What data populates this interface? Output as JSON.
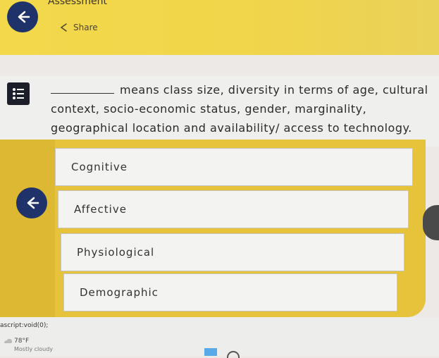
{
  "header": {
    "title": "Assessment",
    "share_label": "Share"
  },
  "question": {
    "text": "means class size, diversity in terms of age, cultural context, socio-economic status, gender, marginality, geographical location and availability/ access to technology."
  },
  "options": [
    {
      "label": "Cognitive"
    },
    {
      "label": "Affective"
    },
    {
      "label": "Physiological"
    },
    {
      "label": "Demographic"
    }
  ],
  "status_bar": {
    "url": "ascript:void(0);",
    "temperature": "78°F",
    "weather": "Mostly cloudy"
  },
  "colors": {
    "accent_yellow": "#e7c33b",
    "nav_blue": "#20326a"
  },
  "icons": [
    "arrow-left-icon",
    "share-icon",
    "list-icon",
    "cloud-sun-icon"
  ]
}
